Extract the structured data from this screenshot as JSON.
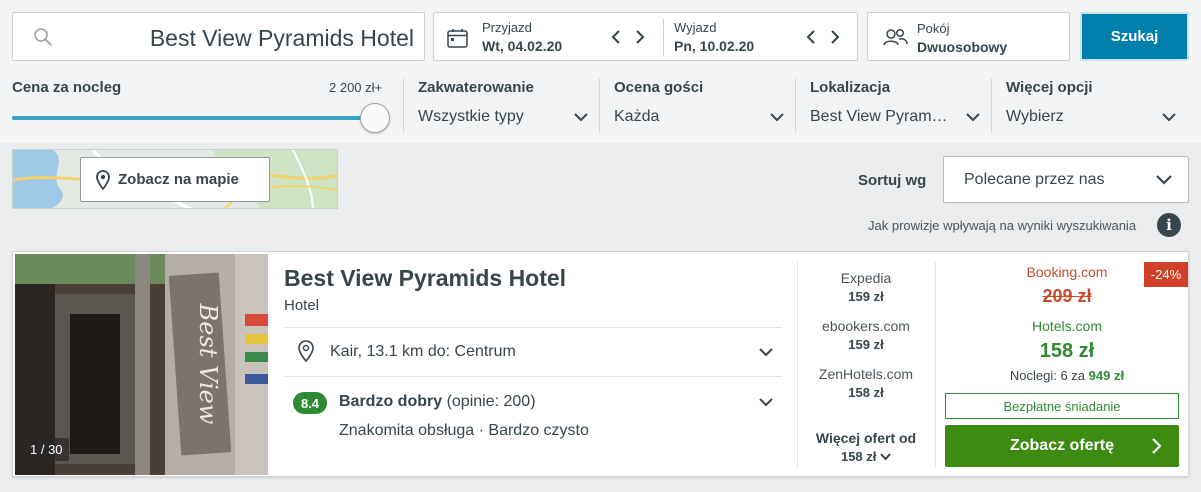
{
  "search": {
    "destination": "Best View Pyramids Hotel",
    "button_label": "Szukaj"
  },
  "dates": {
    "checkin_label": "Przyjazd",
    "checkin_value": "Wt, 04.02.20",
    "checkout_label": "Wyjazd",
    "checkout_value": "Pn, 10.02.20"
  },
  "room": {
    "label": "Pokój",
    "value": "Dwuosobowy"
  },
  "filters": {
    "price": {
      "label": "Cena za nocleg",
      "max_value": "2 200 zł+",
      "slider_fraction": 1.0
    },
    "items": [
      {
        "title": "Zakwaterowanie",
        "value": "Wszystkie typy"
      },
      {
        "title": "Ocena gości",
        "value": "Każda"
      },
      {
        "title": "Lokalizacja",
        "value": "Best View Pyram…"
      },
      {
        "title": "Więcej opcji",
        "value": "Wybierz"
      }
    ]
  },
  "map": {
    "button_label": "Zobacz na mapie"
  },
  "sort": {
    "label": "Sortuj wg",
    "value": "Polecane przez nas"
  },
  "commission_text": "Jak prowizje wpływają na wyniki wyszukiwania",
  "info_glyph": "i",
  "result": {
    "photo_counter": "1 / 30",
    "name": "Best View Pyramids Hotel",
    "type": "Hotel",
    "location": "Kair, 13.1 km do: Centrum",
    "rating_score": "8.4",
    "rating_label": "Bardzo dobry",
    "rating_reviews": "(opinie: 200)",
    "highlights": "Znakomita obsługa · Bardzo czysto",
    "other_offers": [
      {
        "site": "Expedia",
        "price": "159 zł"
      },
      {
        "site": "ebookers.com",
        "price": "159 zł"
      },
      {
        "site": "ZenHotels.com",
        "price": "158 zł"
      }
    ],
    "more_offers_label": "Więcej ofert od",
    "more_offers_price": "158 zł",
    "deal": {
      "compare_site": "Booking.com",
      "compare_price": "209 zł",
      "discount": "-24%",
      "site": "Hotels.com",
      "price": "158 zł",
      "nights_prefix": "Noclegi: 6 za",
      "nights_total": "949 zł",
      "perk": "Bezpłatne śniadanie",
      "cta_label": "Zobacz ofertę"
    }
  },
  "colors": {
    "accent": "#007fad",
    "green": "#2e8b34",
    "cta": "#3d8a11",
    "discount": "#d13f28"
  }
}
